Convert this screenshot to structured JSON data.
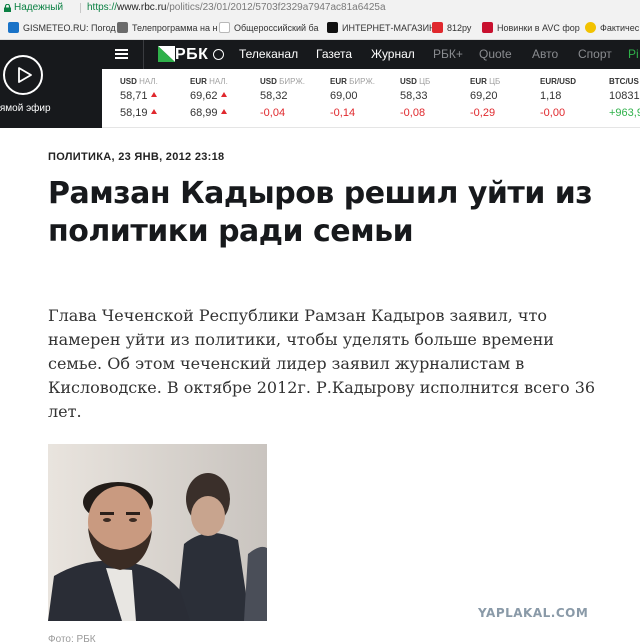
{
  "browser": {
    "secure_label": "Надежный",
    "url_protocol": "https://",
    "url_host": "www.rbc.ru",
    "url_path": "/politics/23/01/2012/5703f2329a7947ac81a6425a"
  },
  "bookmarks": [
    {
      "label": "GISMETEO.RU: Погод",
      "icon": "gismeteo-icon",
      "color": "#1a73c8"
    },
    {
      "label": "Телепрограмма на н",
      "icon": "tv-icon",
      "color": "#6b6b6b"
    },
    {
      "label": "Общероссийский ба",
      "icon": "page-icon",
      "color": "#cccccc"
    },
    {
      "label": "ИНТЕРНЕТ-МАГАЗИН",
      "icon": "shop-icon",
      "color": "#111111"
    },
    {
      "label": "812ру",
      "icon": "forum-icon",
      "color": "#e0282d"
    },
    {
      "label": "Новинки в AVC фор",
      "icon": "avc-icon",
      "color": "#c8102e"
    },
    {
      "label": "Фактичес",
      "icon": "bulb-icon",
      "color": "#f2c200"
    }
  ],
  "header": {
    "live_label": "прямой эфир",
    "logo_text": "РБК",
    "nav": [
      {
        "label": "Телеканал",
        "style": "normal"
      },
      {
        "label": "Газета",
        "style": "normal"
      },
      {
        "label": "Журнал",
        "style": "normal"
      },
      {
        "label": "РБК+",
        "style": "dim"
      },
      {
        "label": "Quote",
        "style": "dim"
      },
      {
        "label": "Авто",
        "style": "dim"
      },
      {
        "label": "Спорт",
        "style": "dim"
      },
      {
        "label": "Pi",
        "style": "green"
      }
    ]
  },
  "rates": [
    {
      "code": "USD",
      "src": "НАЛ.",
      "v1": "58,71",
      "v1_arrow": true,
      "v2": "58,19",
      "v2_arrow": true,
      "v2_class": ""
    },
    {
      "code": "EUR",
      "src": "НАЛ.",
      "v1": "69,62",
      "v1_arrow": true,
      "v2": "68,99",
      "v2_arrow": true,
      "v2_class": ""
    },
    {
      "code": "USD",
      "src": "БИРЖ.",
      "v1": "58,32",
      "v1_arrow": false,
      "v2": "-0,04",
      "v2_arrow": false,
      "v2_class": "neg"
    },
    {
      "code": "EUR",
      "src": "БИРЖ.",
      "v1": "69,00",
      "v1_arrow": false,
      "v2": "-0,14",
      "v2_arrow": false,
      "v2_class": "neg"
    },
    {
      "code": "USD",
      "src": "ЦБ",
      "v1": "58,33",
      "v1_arrow": false,
      "v2": "-0,08",
      "v2_arrow": false,
      "v2_class": "neg"
    },
    {
      "code": "EUR",
      "src": "ЦБ",
      "v1": "69,20",
      "v1_arrow": false,
      "v2": "-0,29",
      "v2_arrow": false,
      "v2_class": "neg"
    },
    {
      "code": "EUR/USD",
      "src": "",
      "v1": "1,18",
      "v1_arrow": false,
      "v2": "-0,00",
      "v2_arrow": false,
      "v2_class": "neg"
    },
    {
      "code": "BTC/US",
      "src": "",
      "v1": "10831",
      "v1_arrow": false,
      "v2": "+963,9",
      "v2_arrow": false,
      "v2_class": "pos"
    }
  ],
  "article": {
    "meta": "ПОЛИТИКА, 23 ЯНВ, 2012 23:18",
    "title": "Рамзан Кадыров решил уйти из политики ради семьи",
    "lead": "Глава Чеченской Республики Рамзан Кадыров заявил, что намерен уйти из политики, чтобы уделять больше времени семье. Об этом чеченский лидер заявил журналистам в Кисловодске. В октябре 2012г. Р.Кадырову исполнится всего 36 лет.",
    "photo_caption": "Фото: РБК"
  },
  "watermark": "YAPLAKAL.COM"
}
